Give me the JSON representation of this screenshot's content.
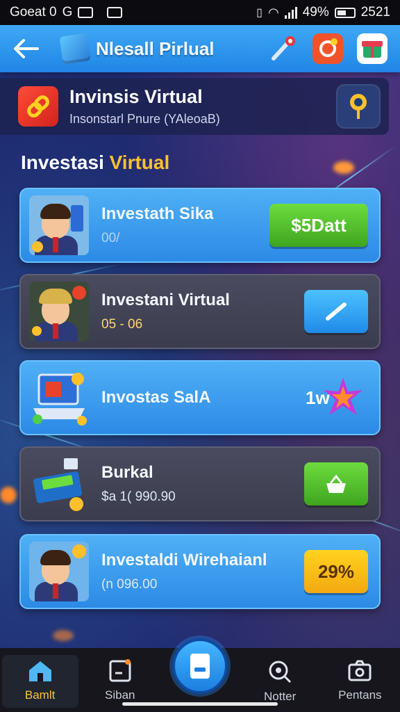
{
  "status_bar": {
    "left_text": "Goeat 0",
    "left_letter": "G",
    "battery": "49%",
    "time": "2521"
  },
  "app_bar": {
    "title": "Nlesall Pirlual",
    "icons": [
      "back-arrow-icon",
      "app-logo-icon",
      "pen-tool-icon",
      "notification-badge-icon",
      "gift-icon"
    ]
  },
  "header_card": {
    "title": "Invinsis Virtual",
    "subtitle": "Insonstarl Pnure (YAleoaB)"
  },
  "section": {
    "title_word1": "Investasi",
    "title_word2": "Virtual"
  },
  "items": [
    {
      "title": "Investath Sika",
      "subtitle": "00/",
      "action_label": "$5Datt",
      "action_type": "green"
    },
    {
      "title": "Investani Virtual",
      "subtitle": "05 - 06",
      "action_label": "",
      "action_type": "blue-edit"
    },
    {
      "title": "Invostas SalA",
      "subtitle": "",
      "action_label": "1w",
      "action_type": "badge"
    },
    {
      "title": "Burkal",
      "subtitle": "$a 1( 990.90",
      "action_label": "",
      "action_type": "green-icon"
    },
    {
      "title": "Investaldi Wirehaianl",
      "subtitle": "(n 096.00",
      "action_label": "29%",
      "action_type": "yellow"
    }
  ],
  "bottom_nav": {
    "items": [
      {
        "label": "Bamlt",
        "icon": "home-icon"
      },
      {
        "label": "Siban",
        "icon": "document-icon"
      },
      {
        "label": "Notter",
        "icon": "search-icon"
      },
      {
        "label": "Pentans",
        "icon": "camera-icon"
      }
    ],
    "fab_icon": "wallet-icon"
  },
  "colors": {
    "accent_yellow": "#ffc02b",
    "primary_blue": "#2c8ae6",
    "green": "#3ea51e"
  }
}
